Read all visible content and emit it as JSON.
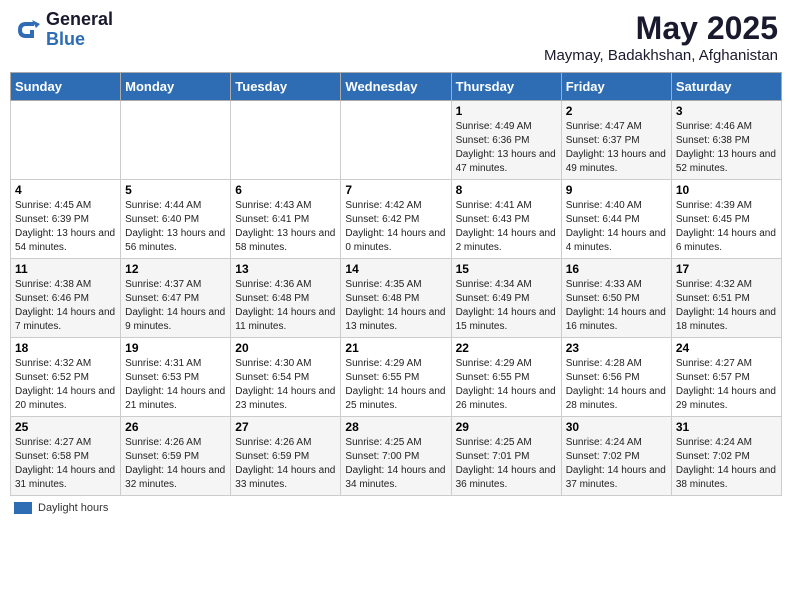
{
  "header": {
    "logo_general": "General",
    "logo_blue": "Blue",
    "month_title": "May 2025",
    "location": "Maymay, Badakhshan, Afghanistan"
  },
  "footer": {
    "daylight_label": "Daylight hours"
  },
  "weekdays": [
    "Sunday",
    "Monday",
    "Tuesday",
    "Wednesday",
    "Thursday",
    "Friday",
    "Saturday"
  ],
  "weeks": [
    [
      {
        "day": "",
        "sunrise": "",
        "sunset": "",
        "daylight": ""
      },
      {
        "day": "",
        "sunrise": "",
        "sunset": "",
        "daylight": ""
      },
      {
        "day": "",
        "sunrise": "",
        "sunset": "",
        "daylight": ""
      },
      {
        "day": "",
        "sunrise": "",
        "sunset": "",
        "daylight": ""
      },
      {
        "day": "1",
        "sunrise": "Sunrise: 4:49 AM",
        "sunset": "Sunset: 6:36 PM",
        "daylight": "Daylight: 13 hours and 47 minutes."
      },
      {
        "day": "2",
        "sunrise": "Sunrise: 4:47 AM",
        "sunset": "Sunset: 6:37 PM",
        "daylight": "Daylight: 13 hours and 49 minutes."
      },
      {
        "day": "3",
        "sunrise": "Sunrise: 4:46 AM",
        "sunset": "Sunset: 6:38 PM",
        "daylight": "Daylight: 13 hours and 52 minutes."
      }
    ],
    [
      {
        "day": "4",
        "sunrise": "Sunrise: 4:45 AM",
        "sunset": "Sunset: 6:39 PM",
        "daylight": "Daylight: 13 hours and 54 minutes."
      },
      {
        "day": "5",
        "sunrise": "Sunrise: 4:44 AM",
        "sunset": "Sunset: 6:40 PM",
        "daylight": "Daylight: 13 hours and 56 minutes."
      },
      {
        "day": "6",
        "sunrise": "Sunrise: 4:43 AM",
        "sunset": "Sunset: 6:41 PM",
        "daylight": "Daylight: 13 hours and 58 minutes."
      },
      {
        "day": "7",
        "sunrise": "Sunrise: 4:42 AM",
        "sunset": "Sunset: 6:42 PM",
        "daylight": "Daylight: 14 hours and 0 minutes."
      },
      {
        "day": "8",
        "sunrise": "Sunrise: 4:41 AM",
        "sunset": "Sunset: 6:43 PM",
        "daylight": "Daylight: 14 hours and 2 minutes."
      },
      {
        "day": "9",
        "sunrise": "Sunrise: 4:40 AM",
        "sunset": "Sunset: 6:44 PM",
        "daylight": "Daylight: 14 hours and 4 minutes."
      },
      {
        "day": "10",
        "sunrise": "Sunrise: 4:39 AM",
        "sunset": "Sunset: 6:45 PM",
        "daylight": "Daylight: 14 hours and 6 minutes."
      }
    ],
    [
      {
        "day": "11",
        "sunrise": "Sunrise: 4:38 AM",
        "sunset": "Sunset: 6:46 PM",
        "daylight": "Daylight: 14 hours and 7 minutes."
      },
      {
        "day": "12",
        "sunrise": "Sunrise: 4:37 AM",
        "sunset": "Sunset: 6:47 PM",
        "daylight": "Daylight: 14 hours and 9 minutes."
      },
      {
        "day": "13",
        "sunrise": "Sunrise: 4:36 AM",
        "sunset": "Sunset: 6:48 PM",
        "daylight": "Daylight: 14 hours and 11 minutes."
      },
      {
        "day": "14",
        "sunrise": "Sunrise: 4:35 AM",
        "sunset": "Sunset: 6:48 PM",
        "daylight": "Daylight: 14 hours and 13 minutes."
      },
      {
        "day": "15",
        "sunrise": "Sunrise: 4:34 AM",
        "sunset": "Sunset: 6:49 PM",
        "daylight": "Daylight: 14 hours and 15 minutes."
      },
      {
        "day": "16",
        "sunrise": "Sunrise: 4:33 AM",
        "sunset": "Sunset: 6:50 PM",
        "daylight": "Daylight: 14 hours and 16 minutes."
      },
      {
        "day": "17",
        "sunrise": "Sunrise: 4:32 AM",
        "sunset": "Sunset: 6:51 PM",
        "daylight": "Daylight: 14 hours and 18 minutes."
      }
    ],
    [
      {
        "day": "18",
        "sunrise": "Sunrise: 4:32 AM",
        "sunset": "Sunset: 6:52 PM",
        "daylight": "Daylight: 14 hours and 20 minutes."
      },
      {
        "day": "19",
        "sunrise": "Sunrise: 4:31 AM",
        "sunset": "Sunset: 6:53 PM",
        "daylight": "Daylight: 14 hours and 21 minutes."
      },
      {
        "day": "20",
        "sunrise": "Sunrise: 4:30 AM",
        "sunset": "Sunset: 6:54 PM",
        "daylight": "Daylight: 14 hours and 23 minutes."
      },
      {
        "day": "21",
        "sunrise": "Sunrise: 4:29 AM",
        "sunset": "Sunset: 6:55 PM",
        "daylight": "Daylight: 14 hours and 25 minutes."
      },
      {
        "day": "22",
        "sunrise": "Sunrise: 4:29 AM",
        "sunset": "Sunset: 6:55 PM",
        "daylight": "Daylight: 14 hours and 26 minutes."
      },
      {
        "day": "23",
        "sunrise": "Sunrise: 4:28 AM",
        "sunset": "Sunset: 6:56 PM",
        "daylight": "Daylight: 14 hours and 28 minutes."
      },
      {
        "day": "24",
        "sunrise": "Sunrise: 4:27 AM",
        "sunset": "Sunset: 6:57 PM",
        "daylight": "Daylight: 14 hours and 29 minutes."
      }
    ],
    [
      {
        "day": "25",
        "sunrise": "Sunrise: 4:27 AM",
        "sunset": "Sunset: 6:58 PM",
        "daylight": "Daylight: 14 hours and 31 minutes."
      },
      {
        "day": "26",
        "sunrise": "Sunrise: 4:26 AM",
        "sunset": "Sunset: 6:59 PM",
        "daylight": "Daylight: 14 hours and 32 minutes."
      },
      {
        "day": "27",
        "sunrise": "Sunrise: 4:26 AM",
        "sunset": "Sunset: 6:59 PM",
        "daylight": "Daylight: 14 hours and 33 minutes."
      },
      {
        "day": "28",
        "sunrise": "Sunrise: 4:25 AM",
        "sunset": "Sunset: 7:00 PM",
        "daylight": "Daylight: 14 hours and 34 minutes."
      },
      {
        "day": "29",
        "sunrise": "Sunrise: 4:25 AM",
        "sunset": "Sunset: 7:01 PM",
        "daylight": "Daylight: 14 hours and 36 minutes."
      },
      {
        "day": "30",
        "sunrise": "Sunrise: 4:24 AM",
        "sunset": "Sunset: 7:02 PM",
        "daylight": "Daylight: 14 hours and 37 minutes."
      },
      {
        "day": "31",
        "sunrise": "Sunrise: 4:24 AM",
        "sunset": "Sunset: 7:02 PM",
        "daylight": "Daylight: 14 hours and 38 minutes."
      }
    ]
  ]
}
